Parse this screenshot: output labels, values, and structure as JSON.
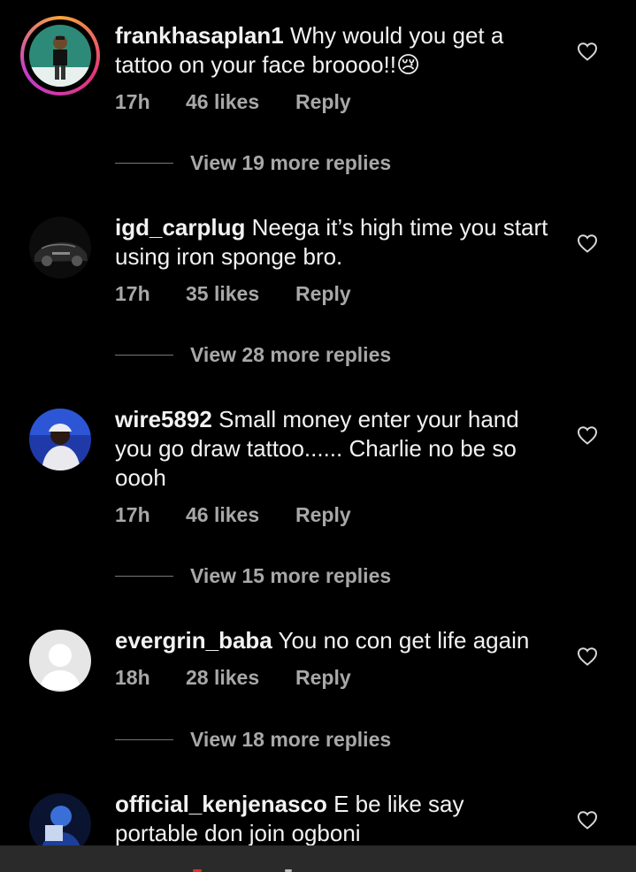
{
  "comments": [
    {
      "username": "frankhasaplan1",
      "text": " Why would you get a tattoo on your face broooo!!😢",
      "time": "17h",
      "likes": "46 likes",
      "reply": "Reply",
      "view_replies": "View 19 more replies",
      "avatar": "cartoon-avatar-story-ring"
    },
    {
      "username": "igd_carplug",
      "text": " Neega it’s high time you start using iron sponge bro.",
      "time": "17h",
      "likes": "35 likes",
      "reply": "Reply",
      "view_replies": "View 28 more replies",
      "avatar": "black-car-photo"
    },
    {
      "username": "wire5892",
      "text": " Small money enter your hand you go draw tattoo...... Charlie no be so oooh",
      "time": "17h",
      "likes": "46 likes",
      "reply": "Reply",
      "view_replies": "View 15 more replies",
      "avatar": "person-photo"
    },
    {
      "username": "evergrin_baba",
      "text": " You no con get life again",
      "time": "18h",
      "likes": "28 likes",
      "reply": "Reply",
      "view_replies": "View 18 more replies",
      "avatar": "default-avatar"
    },
    {
      "username": "official_kenjenasco",
      "text": " E be like say portable don join ogboni",
      "avatar": "person-photo-blue"
    }
  ],
  "icons": {
    "like": "heart-outline-icon"
  },
  "colors": {
    "background": "#000000",
    "secondary_text": "#a8a8a8",
    "primary_text": "#f2f2f2"
  }
}
